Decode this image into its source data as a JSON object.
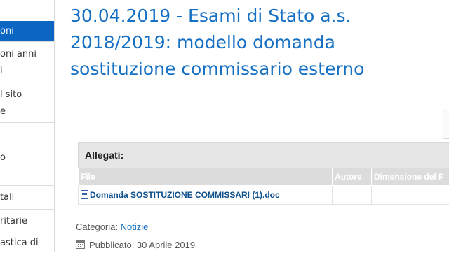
{
  "sidebar": {
    "items": [
      {
        "lines": [
          "oni"
        ],
        "active": true
      },
      {
        "lines": [
          "oni anni",
          "i"
        ],
        "active": false
      },
      {
        "lines": [
          "l sito",
          "e"
        ],
        "active": false
      },
      {
        "lines": [
          ""
        ],
        "active": false
      },
      {
        "lines": [
          "o"
        ],
        "active": false
      },
      {
        "lines": [
          ""
        ],
        "active": false
      },
      {
        "lines": [
          "tali"
        ],
        "active": false
      },
      {
        "lines": [
          "ritarie"
        ],
        "active": false
      },
      {
        "lines": [
          "astica di"
        ],
        "active": false
      }
    ]
  },
  "article": {
    "title_lines": [
      "30.04.2019 - Esami di Stato a.s.",
      "2018/2019: modello domanda",
      "sostituzione commissario esterno"
    ]
  },
  "attachments": {
    "heading": "Allegati:",
    "columns": [
      "File",
      "Autore",
      "Dimensione del F"
    ],
    "rows": [
      {
        "file": "Domanda SOSTITUZIONE COMMISSARI (1).doc",
        "author": "",
        "size": ""
      }
    ]
  },
  "meta": {
    "category_label": "Categoria:",
    "category_value": "Notizie",
    "published_text": "Pubblicato: 30 Aprile 2019"
  },
  "colors": {
    "accent": "#0a66c2",
    "title": "#1570c4",
    "link": "#0b4f8a"
  }
}
